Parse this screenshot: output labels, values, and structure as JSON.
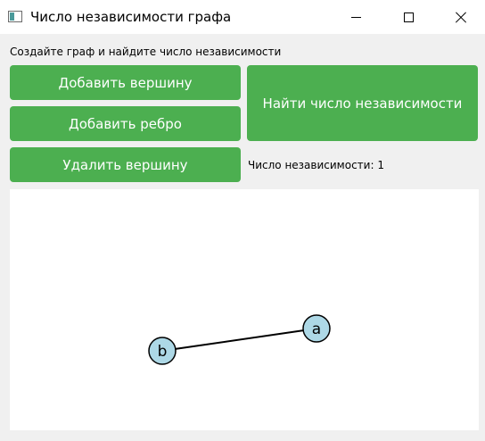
{
  "window": {
    "title": "Число независимости графа",
    "icon": "app-window-icon",
    "controls": [
      "minimize-icon",
      "maximize-icon",
      "close-icon"
    ]
  },
  "instruction": "Создайте граф и найдите число независимости",
  "buttons": {
    "add_vertex": "Добавить вершину",
    "add_edge": "Добавить ребро",
    "delete_vertex": "Удалить вершину",
    "find_independence": "Найти число независимости"
  },
  "result_label": "Число независимости: 1",
  "graph": {
    "vertices": [
      {
        "id": "a",
        "label": "a"
      },
      {
        "id": "b",
        "label": "b"
      }
    ],
    "edges": [
      {
        "from": "b",
        "to": "a"
      }
    ]
  },
  "colors": {
    "button_green": "#4caf50",
    "vertex_fill": "#add8e6",
    "edge_stroke": "#000000"
  }
}
